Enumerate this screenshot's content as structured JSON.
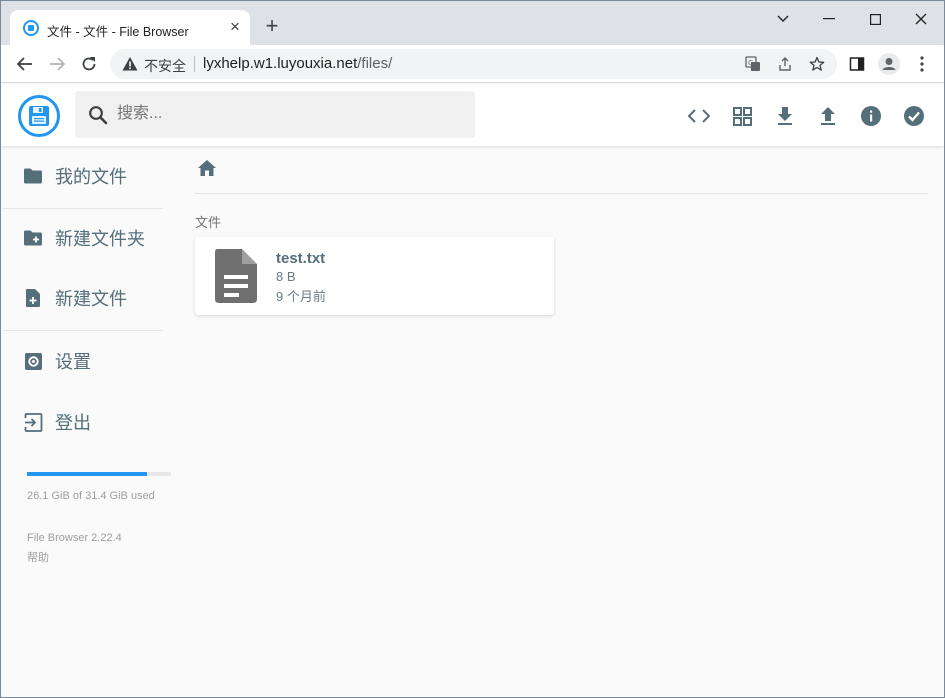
{
  "browser": {
    "tab_title": "文件 - 文件 - File Browser",
    "security_label": "不安全",
    "url_host": "lyxhelp.w1.luyouxia.net",
    "url_path": "/files/"
  },
  "header": {
    "search_placeholder": "搜索...",
    "actions": [
      "code-icon",
      "grid-view-icon",
      "download-icon",
      "upload-icon",
      "info-icon",
      "check-circle-icon"
    ]
  },
  "sidebar": {
    "items": [
      {
        "label": "我的文件",
        "icon": "folder-icon"
      },
      {
        "label": "新建文件夹",
        "icon": "new-folder-icon"
      },
      {
        "label": "新建文件",
        "icon": "new-file-icon"
      },
      {
        "label": "设置",
        "icon": "settings-icon"
      },
      {
        "label": "登出",
        "icon": "logout-icon"
      }
    ],
    "usage_text": "26.1 GiB of 31.4 GiB used",
    "usage_fraction": 0.83,
    "version_text": "File Browser 2.22.4",
    "help_text": "帮助"
  },
  "listing": {
    "section_title": "文件",
    "files": [
      {
        "name": "test.txt",
        "size": "8 B",
        "modified": "9 个月前"
      }
    ]
  },
  "colors": {
    "accent": "#2196f3",
    "sidebar_text": "#546e7a"
  }
}
